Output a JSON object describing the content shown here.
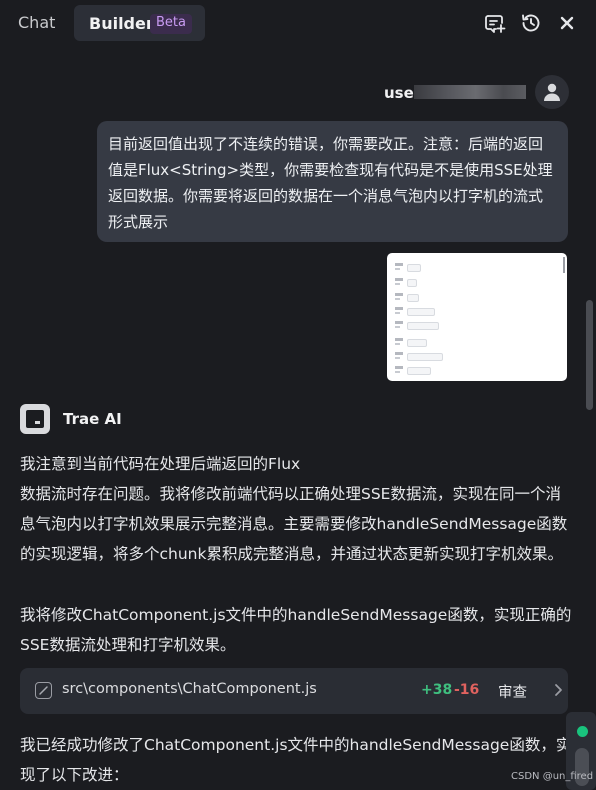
{
  "header": {
    "tabs": [
      {
        "label": "Chat"
      },
      {
        "label": "Builder",
        "badge": "Beta"
      }
    ],
    "icons": [
      "new-chat-icon",
      "history-icon",
      "close-icon"
    ]
  },
  "user": {
    "name_visible": "user"
  },
  "user_message": {
    "text": "目前返回值出现了不连续的错误，你需要改正。注意：后端的返回值是Flux<String>类型，你需要检查现有代码是不是使用SSE处理返回数据。你需要将返回的数据在一个消息气泡内以打字机的流式形式展示"
  },
  "assistant": {
    "name": "Trae AI",
    "paragraphs": [
      "我注意到当前代码在处理后端返回的Flux\n数据流时存在问题。我将修改前端代码以正确处理SSE数据流，实现在同一个消息气泡内以打字机效果展示完整消息。主要需要修改handleSendMessage函数的实现逻辑，将多个chunk累积成完整消息，并通过状态更新实现打字机效果。",
      "我将修改ChatComponent.js文件中的handleSendMessage函数，实现正确的SSE数据流处理和打字机效果。",
      "我已经成功修改了ChatComponent.js文件中的handleSendMessage函数，实现了以下改进："
    ],
    "file_change": {
      "path": "src\\components\\ChatComponent.js",
      "additions": "+38",
      "deletions": "-16",
      "action": "审查"
    }
  },
  "watermark": "CSDN @un_fired",
  "colors": {
    "background": "#1b1c20",
    "bubble": "#363a44",
    "badge_text": "#c89bf2",
    "added": "#3fbf7f",
    "deleted": "#e0625f",
    "status_dot": "#19c37d"
  }
}
